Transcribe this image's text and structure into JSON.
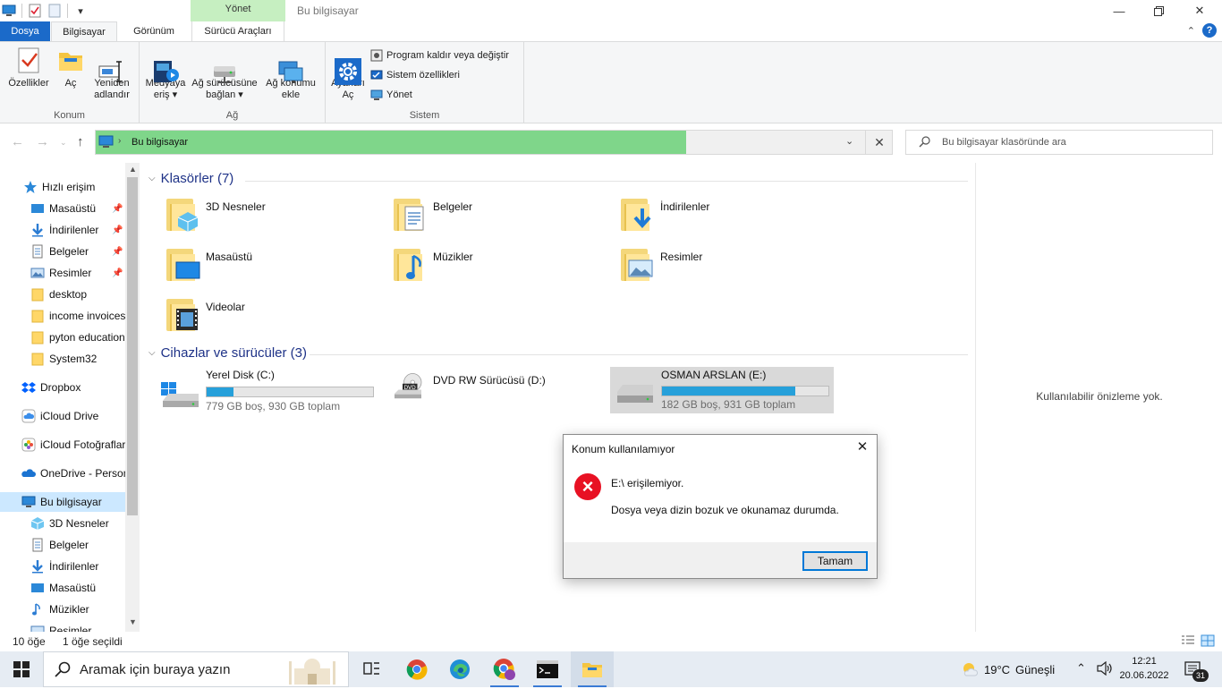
{
  "window": {
    "title": "Bu bilgisayar",
    "context_tab_header": "Yönet"
  },
  "ribbon_tabs": [
    "Dosya",
    "Bilgisayar",
    "Görünüm",
    "Sürücü Araçları"
  ],
  "ribbon": {
    "konum": {
      "label": "Konum",
      "buttons": [
        "Özellikler",
        "Aç",
        "Yeniden\nadlandır"
      ]
    },
    "ag": {
      "label": "Ağ",
      "buttons": [
        "Medyaya\neriş ▾",
        "Ağ sürücüsüne\nbağlan ▾",
        "Ağ konumu\nekle"
      ]
    },
    "sistem": {
      "label": "Sistem",
      "open_settings": "Ayarları\nAç",
      "uninstall": "Program kaldır veya değiştir",
      "system_props": "Sistem özellikleri",
      "manage": "Yönet"
    }
  },
  "address": {
    "path": "Bu bilgisayar",
    "search_placeholder": "Bu bilgisayar klasöründe ara"
  },
  "sidebar": {
    "quick_access": "Hızlı erişim",
    "quick_items": [
      {
        "label": "Masaüstü",
        "pinned": true
      },
      {
        "label": "İndirilenler",
        "pinned": true
      },
      {
        "label": "Belgeler",
        "pinned": true
      },
      {
        "label": "Resimler",
        "pinned": true
      },
      {
        "label": "desktop",
        "pinned": false
      },
      {
        "label": "income invoices",
        "pinned": false
      },
      {
        "label": "pyton education",
        "pinned": false
      },
      {
        "label": "System32",
        "pinned": false
      }
    ],
    "dropbox": "Dropbox",
    "icloud_drive": "iCloud Drive",
    "icloud_photos": "iCloud Fotoğrafları",
    "onedrive": "OneDrive - Personal",
    "this_pc": "Bu bilgisayar",
    "pc_items": [
      "3D Nesneler",
      "Belgeler",
      "İndirilenler",
      "Masaüstü",
      "Müzikler",
      "Resimler"
    ]
  },
  "folders_group": {
    "title": "Klasörler (7)",
    "items": [
      "3D Nesneler",
      "Belgeler",
      "İndirilenler",
      "Masaüstü",
      "Müzikler",
      "Resimler",
      "Videolar"
    ]
  },
  "drives_group": {
    "title": "Cihazlar ve sürücüler (3)",
    "drives": [
      {
        "name": "Yerel Disk (C:)",
        "free_text": "779 GB boş, 930 GB toplam",
        "used_fraction": 0.16
      },
      {
        "name": "DVD RW Sürücüsü (D:)"
      },
      {
        "name": "OSMAN ARSLAN (E:)",
        "free_text": "182 GB boş, 931 GB toplam",
        "used_fraction": 0.8
      }
    ]
  },
  "preview": {
    "text": "Kullanılabilir önizleme yok."
  },
  "status": {
    "count": "10 öğe",
    "selected": "1 öğe seçildi"
  },
  "dialog": {
    "title": "Konum kullanılamıyor",
    "message1": "E:\\ erişilemiyor.",
    "message2": "Dosya veya dizin bozuk ve okunamaz durumda.",
    "ok": "Tamam"
  },
  "taskbar": {
    "search_placeholder": "Aramak için buraya yazın",
    "temperature": "19°C",
    "weather": "Güneşli",
    "time": "12:21",
    "date": "20.06.2022",
    "notification_count": "31"
  },
  "colors": {
    "accent": "#1b6ac9",
    "address_fill": "#7fd68a",
    "drive_bar": "#26a0da",
    "error": "#e81123"
  }
}
